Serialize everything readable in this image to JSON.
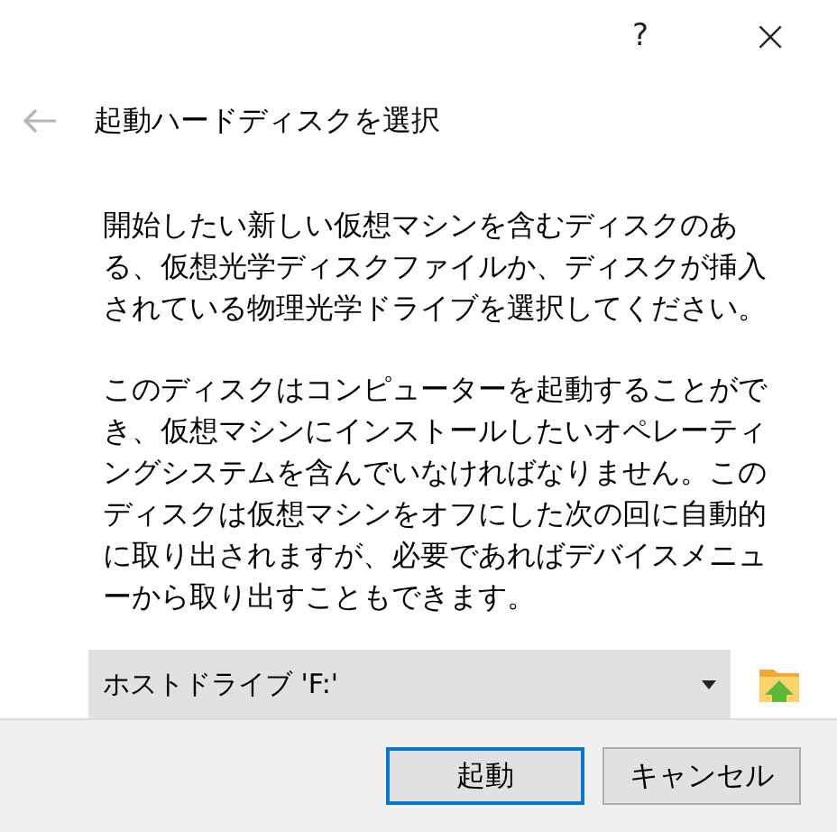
{
  "title_bar": {
    "help": "?",
    "close": "×"
  },
  "title": "起動ハードディスクを選択",
  "paragraphs": [
    "開始したい新しい仮想マシンを含むディスクのある、仮想光学ディスクファイルか、ディスクが挿入されている物理光学ドライブを選択してください。",
    "このディスクはコンピューターを起動することができ、仮想マシンにインストールしたいオペレーティングシステムを含んでいなければなりません。このディスクは仮想マシンをオフにした次の回に自動的に取り出されますが、必要であればデバイスメニューから取り出すこともできます。"
  ],
  "drive_select": {
    "value": "ホストドライブ 'F:'"
  },
  "buttons": [
    {
      "label": "起動",
      "default": true
    },
    {
      "label": "キャンセル",
      "default": false
    }
  ]
}
